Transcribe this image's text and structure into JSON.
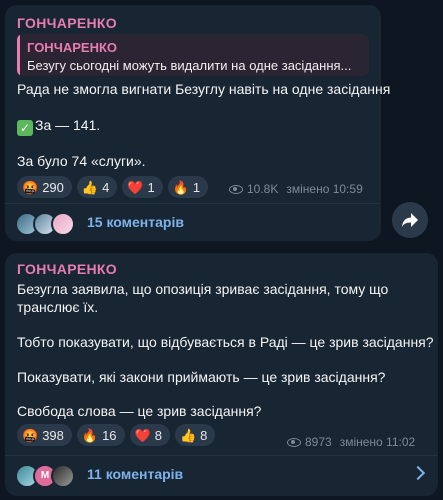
{
  "msg1": {
    "author": "ГОНЧАРЕНКО",
    "reply": {
      "author": "ГОНЧАРЕНКО",
      "text": "Безугу сьогодні можуть видалити на одне засідання..."
    },
    "lines": [
      "Рада не змогла вигнати Безуглу навіть на одне засідання",
      "За — 141.",
      "За було 74 «слуги»."
    ],
    "check_icon": "✅",
    "reactions": [
      {
        "icon": "🤬",
        "count": "290"
      },
      {
        "icon": "👍",
        "count": "4"
      },
      {
        "icon": "❤️",
        "count": "1"
      },
      {
        "icon": "🔥",
        "count": "1"
      }
    ],
    "views": "10.8K",
    "time": "змінено 10:59",
    "comments": "15 коментарів"
  },
  "msg2": {
    "author": "ГОНЧАРЕНКО",
    "lines": [
      "Безугла заявила, що опозиція зриває засідання, тому що",
      "транслює їх.",
      "Тобто показувати, що відбувається в Раді — це зрив засідання?",
      "Показувати, які закони приймають — це зрив засідання?",
      "Свобода слова — це зрив засідання?"
    ],
    "reactions": [
      {
        "icon": "🤬",
        "count": "398"
      },
      {
        "icon": "🔥",
        "count": "16"
      },
      {
        "icon": "❤️",
        "count": "8"
      },
      {
        "icon": "👍",
        "count": "8"
      }
    ],
    "views": "8973",
    "time": "змінено 11:02",
    "comments": "11 коментарів",
    "avatar_letter": "M"
  }
}
